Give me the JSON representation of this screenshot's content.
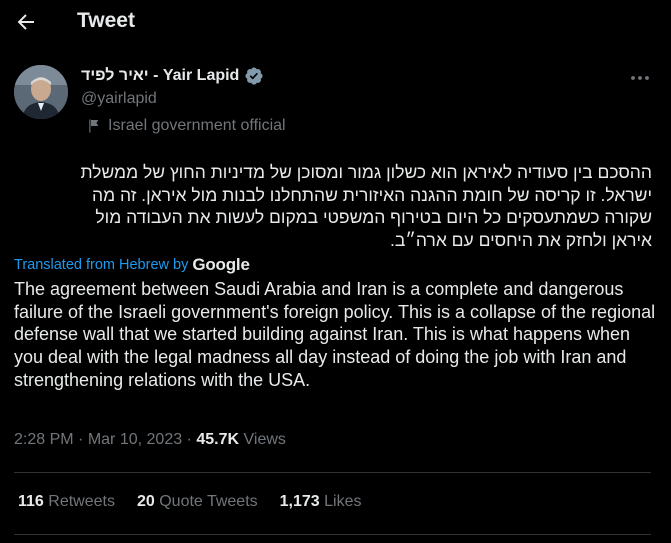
{
  "header": {
    "title": "Tweet"
  },
  "author": {
    "display_name": "יאיר לפיד - Yair Lapid",
    "handle": "@yairlapid",
    "affiliation": "Israel government official"
  },
  "tweet": {
    "hebrew_text": "ההסכם בין סעודיה לאיראן הוא כשלון גמור ומסוכן של מדיניות החוץ של ממשלת\nישראל. זו קריסה של חומת ההגנה האיזורית שהתחלנו לבנות מול איראן. זה מה\nשקורה כשמתעסקים כל היום בטירוף המשפטי במקום לעשות את העבודה מול\nאיראן ולחזק את היחסים עם ארה״ב.",
    "translated_label": "Translated from Hebrew by",
    "translator": "Google",
    "english_text": "The agreement between Saudi Arabia and Iran is a complete and dangerous failure of the Israeli government's foreign policy. This is a collapse of the regional defense wall that we started building against Iran. This is what happens when you deal with the legal madness all day instead of doing the job with Iran and strengthening relations with the USA."
  },
  "meta": {
    "time": "2:28 PM",
    "date": "Mar 10, 2023",
    "separator": "·",
    "views_count": "45.7K",
    "views_label": "Views"
  },
  "stats": {
    "retweets_count": "116",
    "retweets_label": "Retweets",
    "quotes_count": "20",
    "quotes_label": "Quote Tweets",
    "likes_count": "1,173",
    "likes_label": "Likes"
  },
  "colors": {
    "background": "#000000",
    "accent": "#1d9bf0",
    "muted": "#71767b"
  },
  "icons": [
    "back-arrow-icon",
    "verified-badge-icon",
    "flag-icon",
    "more-icon"
  ]
}
